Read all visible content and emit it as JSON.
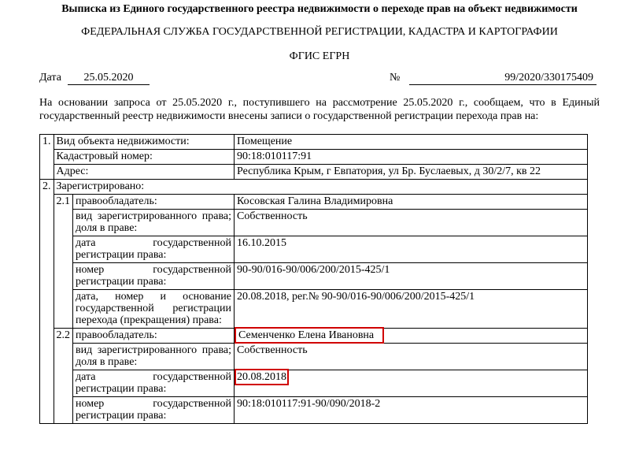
{
  "document": {
    "title": "Выписка из Единого государственного реестра недвижимости о переходе прав на объект недвижимости",
    "agency": "ФЕДЕРАЛЬНАЯ СЛУЖБА ГОСУДАРСТВЕННОЙ РЕГИСТРАЦИИ, КАДАСТРА И КАРТОГРАФИИ",
    "system": "ФГИС ЕГРН",
    "date_label": "Дата",
    "date_value": "25.05.2020",
    "number_label": "№",
    "number_value": "99/2020/330175409",
    "intro": "На основании запроса от 25.05.2020 г., поступившего на рассмотрение 25.05.2020 г., сообщаем, что в Единый государственный реестр недвижимости внесены записи о государственной регистрации перехода прав на:"
  },
  "table": {
    "s1_num": "1.",
    "s1_type_label": "Вид объекта недвижимости:",
    "s1_type_value": "Помещение",
    "s1_cad_label": "Кадастровый номер:",
    "s1_cad_value": "90:18:010117:91",
    "s1_addr_label": "Адрес:",
    "s1_addr_value": "Республика Крым, г Евпатория, ул Бр. Буслаевых, д 30/2/7, кв 22",
    "s2_num": "2.",
    "s2_label": "Зарегистрировано:",
    "r21_num": "2.1",
    "r21_owner_label": "правообладатель:",
    "r21_owner_value": "Косовская Галина Владимировна",
    "r21_right_label": "вид зарегистрированного права; доля в праве:",
    "r21_right_value": "Собственность",
    "r21_date_label": "дата государственной регистрации права:",
    "r21_date_value": "16.10.2015",
    "r21_no_label": "номер государственной регистрации права:",
    "r21_no_value": "90-90/016-90/006/200/2015-425/1",
    "r21_basis_label": "дата, номер и основание государственной регистрации перехода (прекращения) права:",
    "r21_basis_value": "20.08.2018, рег.№ 90-90/016-90/006/200/2015-425/1",
    "r22_num": "2.2",
    "r22_owner_label": "правообладатель:",
    "r22_owner_value": "Семенченко Елена Ивановна",
    "r22_right_label": "вид зарегистрированного права; доля в праве:",
    "r22_right_value": "Собственность",
    "r22_date_label": "дата государственной регистрации права:",
    "r22_date_value": "20.08.2018",
    "r22_no_label": "номер государственной регистрации права:",
    "r22_no_value": "90:18:010117:91-90/090/2018-2"
  },
  "highlight_color": "#d00000"
}
